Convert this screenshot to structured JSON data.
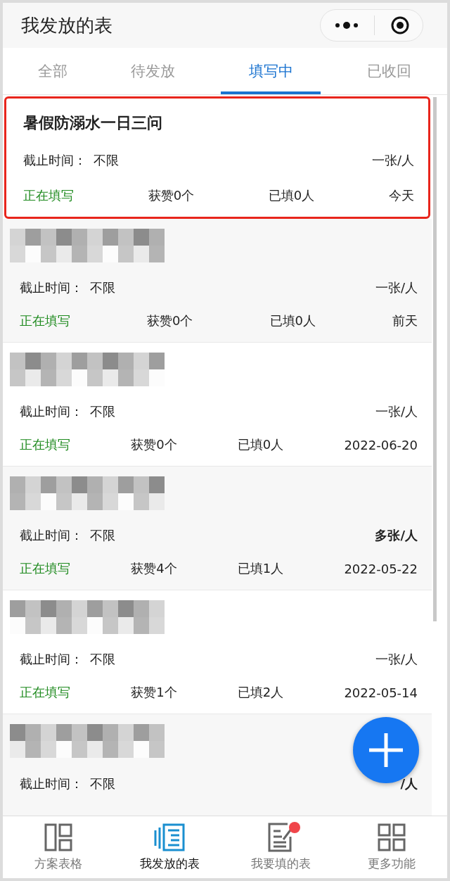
{
  "window": {
    "title": "我发放的表"
  },
  "tabs": [
    {
      "label": "全部",
      "selected": false
    },
    {
      "label": "待发放",
      "selected": false
    },
    {
      "label": "填写中",
      "selected": true
    },
    {
      "label": "已收回",
      "selected": false
    }
  ],
  "forms": [
    {
      "kind": "titled",
      "title": "暑假防溺水一日三问",
      "selected": true,
      "deadline_label": "截止时间：",
      "deadline": "不限",
      "quota": "一张/人",
      "quota_emphasis": false,
      "status": "正在填写",
      "likes": "获赞0个",
      "filled": "已填0人",
      "date": "今天"
    },
    {
      "kind": "redacted",
      "selected": false,
      "deadline_label": "截止时间：",
      "deadline": "不限",
      "quota": "一张/人",
      "quota_emphasis": false,
      "status": "正在填写",
      "likes": "获赞0个",
      "filled": "已填0人",
      "date": "前天"
    },
    {
      "kind": "redacted",
      "selected": false,
      "deadline_label": "截止时间：",
      "deadline": "不限",
      "quota": "一张/人",
      "quota_emphasis": false,
      "status": "正在填写",
      "likes": "获赞0个",
      "filled": "已填0人",
      "date": "2022-06-20"
    },
    {
      "kind": "redacted",
      "selected": false,
      "deadline_label": "截止时间：",
      "deadline": "不限",
      "quota": "多张/人",
      "quota_emphasis": true,
      "status": "正在填写",
      "likes": "获赞4个",
      "filled": "已填1人",
      "date": "2022-05-22"
    },
    {
      "kind": "redacted",
      "selected": false,
      "deadline_label": "截止时间：",
      "deadline": "不限",
      "quota": "一张/人",
      "quota_emphasis": false,
      "status": "正在填写",
      "likes": "获赞1个",
      "filled": "已填2人",
      "date": "2022-05-14"
    },
    {
      "kind": "redacted",
      "selected": false,
      "deadline_label": "截止时间：",
      "deadline": "不限",
      "quota": "/人",
      "quota_emphasis": true
    }
  ],
  "nav": [
    {
      "label": "方案表格",
      "kind": "layout",
      "selected": false,
      "badge": false
    },
    {
      "label": "我发放的表",
      "kind": "document",
      "selected": true,
      "badge": false
    },
    {
      "label": "我要填的表",
      "kind": "edit",
      "selected": false,
      "badge": true
    },
    {
      "label": "更多功能",
      "kind": "grid",
      "selected": false,
      "badge": false
    }
  ]
}
